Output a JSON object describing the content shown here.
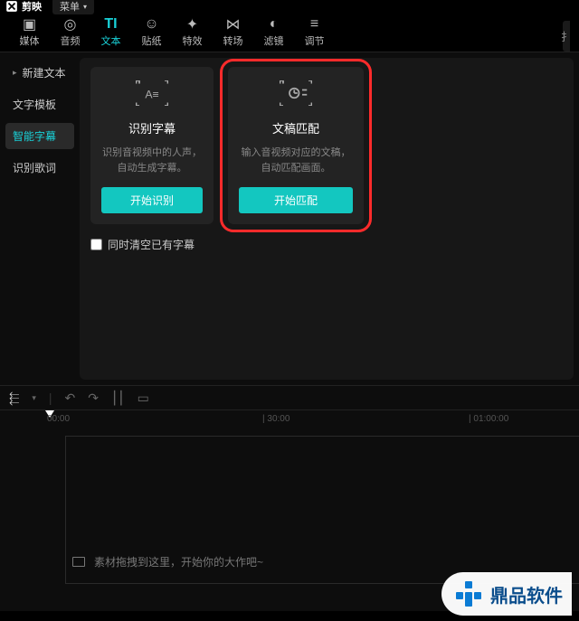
{
  "app": {
    "name": "剪映",
    "menu_label": "菜单"
  },
  "tooltabs": [
    {
      "label": "媒体"
    },
    {
      "label": "音频"
    },
    {
      "label": "文本"
    },
    {
      "label": "贴纸"
    },
    {
      "label": "特效"
    },
    {
      "label": "转场"
    },
    {
      "label": "滤镜"
    },
    {
      "label": "调节"
    }
  ],
  "sidebar": {
    "items": [
      {
        "label": "新建文本"
      },
      {
        "label": "文字模板"
      },
      {
        "label": "智能字幕"
      },
      {
        "label": "识别歌词"
      }
    ]
  },
  "cards": [
    {
      "title": "识别字幕",
      "desc": "识别音视频中的人声，自动生成字幕。",
      "btn": "开始识别"
    },
    {
      "title": "文稿匹配",
      "desc": "输入音视频对应的文稿，自动匹配画面。",
      "btn": "开始匹配"
    }
  ],
  "clear_label": "同时清空已有字幕",
  "ruler": {
    "t0": "00:00",
    "t1": "| 30:00",
    "t2": "| 01:00:00"
  },
  "drop_hint": "素材拖拽到这里，开始你的大作吧~",
  "watermark": "鼎品软件"
}
